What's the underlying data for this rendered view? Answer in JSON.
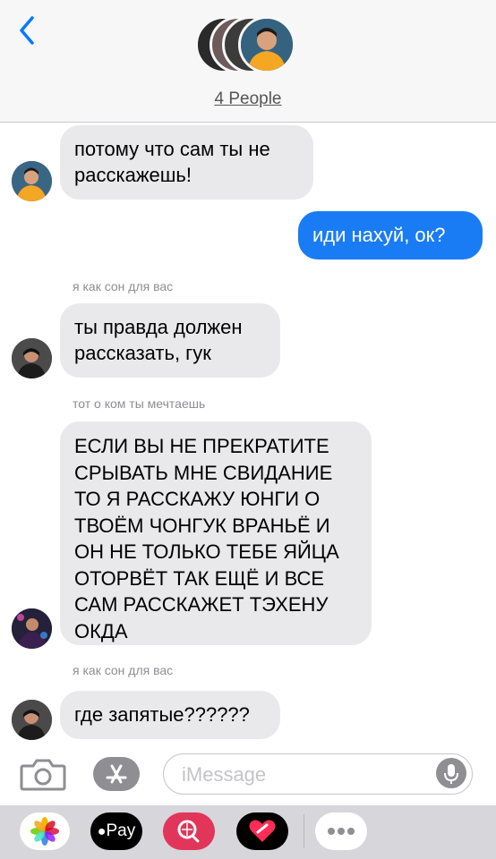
{
  "header": {
    "group_label": "4 People"
  },
  "messages": [
    {
      "text": "потому что сам ты не расскажешь!"
    },
    {
      "text": "иди нахуй, ок?"
    },
    {
      "sender": "я как сон для вас",
      "text": "ты правда должен рассказать, гук"
    },
    {
      "sender": "тот о ком ты мечтаешь",
      "text": "ЕСЛИ ВЫ НЕ ПРЕКРАТИТЕ СРЫВАТЬ МНЕ СВИДАНИЕ ТО Я РАССКАЖУ ЮНГИ О ТВОЁМ ЧОНГУК ВРАНЬЁ И ОН НЕ ТОЛЬКО ТЕБЕ ЯЙЦА ОТОРВЁТ ТАК ЕЩЁ И ВСЕ САМ РАССКАЖЕТ ТЭХЕНУ ОКДА"
    },
    {
      "sender": "я как сон для вас",
      "text": "где запятые??????"
    }
  ],
  "composer": {
    "placeholder": "iMessage"
  },
  "app_tray": {
    "apple_pay_label": "Pay"
  },
  "colors": {
    "outgoing_bubble": "#1a7cf5",
    "incoming_bubble": "#e9e9eb",
    "accent": "#007aff"
  }
}
